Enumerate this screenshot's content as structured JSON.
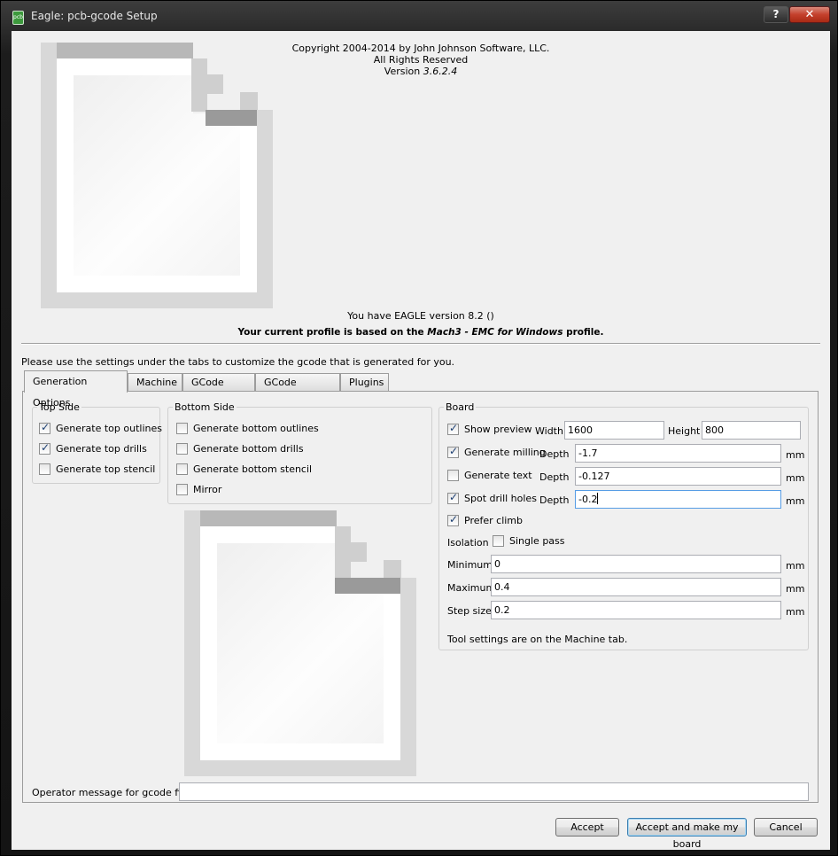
{
  "window": {
    "title": "Eagle: pcb-gcode Setup",
    "help_label": "?",
    "close_label": "✕"
  },
  "header": {
    "copyright": "Copyright 2004-2014 by John Johnson Software, LLC.",
    "rights": "All Rights Reserved",
    "version_prefix": "Version",
    "version_number": "3.6.2.4",
    "eagle_version": "You have EAGLE version 8.2 ()",
    "profile_prefix": "Your current profile is based on the",
    "profile_name": "Mach3 - EMC for Windows",
    "profile_suffix": "profile."
  },
  "intro_text": "Please use the settings under the tabs to customize the gcode that is generated for you.",
  "tabs": [
    {
      "label": "Generation Options",
      "active": true
    },
    {
      "label": "Machine",
      "active": false
    },
    {
      "label": "GCode Style",
      "active": false
    },
    {
      "label": "GCode Options",
      "active": false
    },
    {
      "label": "Plugins",
      "active": false
    }
  ],
  "top_side": {
    "title": "Top Side",
    "options": [
      {
        "label": "Generate top outlines",
        "checked": true
      },
      {
        "label": "Generate top drills",
        "checked": true
      },
      {
        "label": "Generate top stencil",
        "checked": false
      }
    ]
  },
  "bottom_side": {
    "title": "Bottom Side",
    "options": [
      {
        "label": "Generate bottom outlines",
        "checked": false
      },
      {
        "label": "Generate bottom drills",
        "checked": false
      },
      {
        "label": "Generate bottom stencil",
        "checked": false
      },
      {
        "label": "Mirror",
        "checked": false
      }
    ]
  },
  "board": {
    "title": "Board",
    "show_preview": {
      "label": "Show preview",
      "checked": true
    },
    "width_label": "Width",
    "width_value": "1600",
    "height_label": "Height",
    "height_value": "800",
    "milling": {
      "label": "Generate milling",
      "checked": true,
      "depth_label": "Depth",
      "depth_value": "-1.7",
      "unit": "mm"
    },
    "text": {
      "label": "Generate text",
      "checked": false,
      "depth_label": "Depth",
      "depth_value": "-0.127",
      "unit": "mm"
    },
    "spot_drill": {
      "label": "Spot drill holes",
      "checked": true,
      "depth_label": "Depth",
      "depth_value": "-0.2",
      "unit": "mm"
    },
    "prefer_climb": {
      "label": "Prefer climb",
      "checked": true
    },
    "isolation_label": "Isolation",
    "single_pass": {
      "label": "Single pass",
      "checked": false
    },
    "minimum": {
      "label": "Minimum",
      "value": "0",
      "unit": "mm"
    },
    "maximum": {
      "label": "Maximum",
      "value": "0.4",
      "unit": "mm"
    },
    "step_size": {
      "label": "Step size",
      "value": "0.2",
      "unit": "mm"
    },
    "tool_note": "Tool settings are on the Machine tab."
  },
  "operator": {
    "label": "Operator message for gcode file:",
    "value": ""
  },
  "buttons": {
    "accept": "Accept",
    "accept_make": "Accept and make my board",
    "cancel": "Cancel"
  }
}
